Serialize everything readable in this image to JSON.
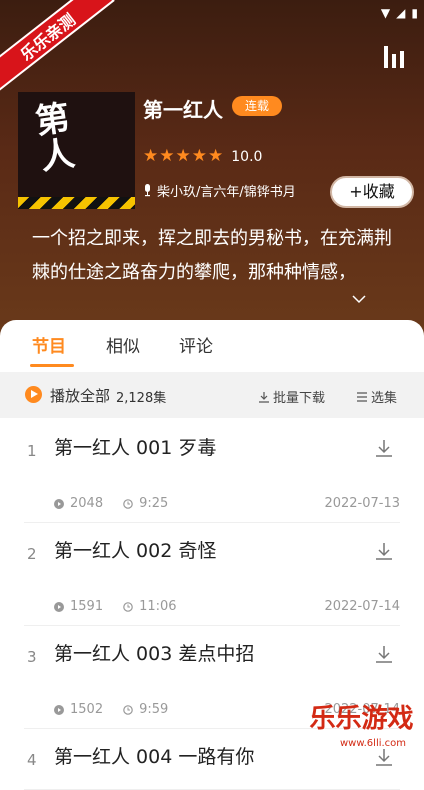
{
  "status": {
    "signal_icon": "signal-icon",
    "wifi_icon": "wifi-icon",
    "battery_icon": "battery-icon"
  },
  "ribbon": {
    "text": "乐乐亲测"
  },
  "header": {
    "equalizer_icon": "equalizer-icon"
  },
  "book": {
    "title": "第一红人",
    "badge": "连载",
    "stars": 5,
    "score": "10.0",
    "narrator": "柴小玖/言六年/锦铧书月",
    "favorite_label": "+收藏",
    "description": "一个招之即来，挥之即去的男秘书，在充满荆棘的仕途之路奋力的攀爬，那种种情感，"
  },
  "tabs": [
    "节目",
    "相似",
    "评论"
  ],
  "playbar": {
    "play_all": "播放全部",
    "count": "2,128集",
    "batch_download": "批量下载",
    "select": "选集"
  },
  "episodes": [
    {
      "no": "1",
      "title": "第一红人 001 歹毒",
      "plays": "2048",
      "duration": "9:25",
      "date": "2022-07-13"
    },
    {
      "no": "2",
      "title": "第一红人 002 奇怪",
      "plays": "1591",
      "duration": "11:06",
      "date": "2022-07-14"
    },
    {
      "no": "3",
      "title": "第一红人 003 差点中招",
      "plays": "1502",
      "duration": "9:59",
      "date": "2022-07-14"
    },
    {
      "no": "4",
      "title": "第一红人 004 一路有你",
      "plays": "",
      "duration": "",
      "date": ""
    }
  ],
  "watermark": {
    "text": "乐乐游戏",
    "sub": "www.6lli.com"
  }
}
